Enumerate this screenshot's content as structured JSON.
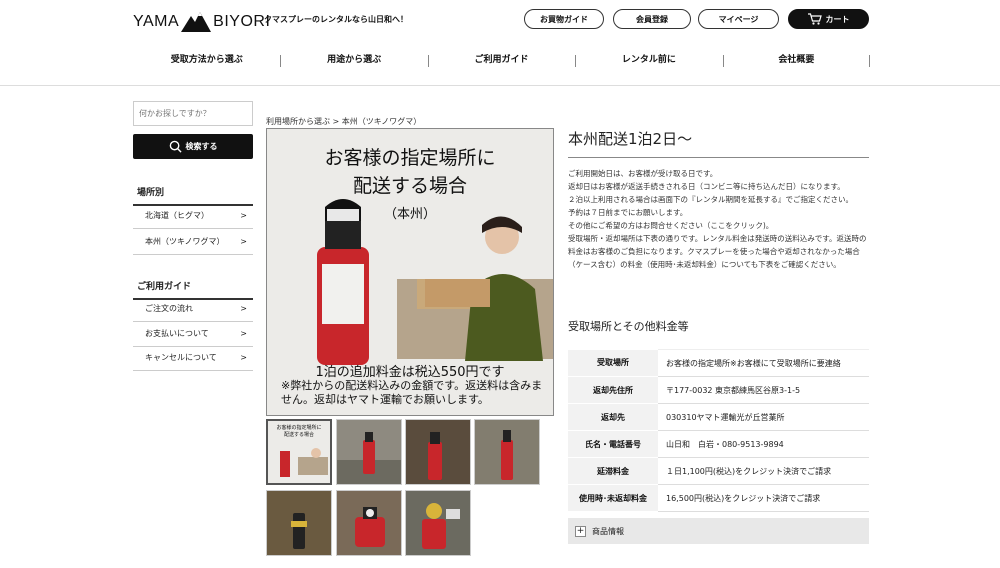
{
  "header": {
    "logo_left": "YAMA",
    "logo_right": "BIYORI",
    "tagline": "クマスプレーのレンタルなら山日和へ！",
    "buttons": {
      "guide": "お買物ガイド",
      "register": "会員登録",
      "mypage": "マイページ",
      "cart": "カート"
    },
    "nav": [
      "受取方法から選ぶ",
      "用途から選ぶ",
      "ご利用ガイド",
      "レンタル前に",
      "会社概要"
    ]
  },
  "sidebar": {
    "search_placeholder": "何かお探しですか？",
    "search_button": "検索する",
    "section1_title": "場所別",
    "section1_items": [
      "北海道（ヒグマ）",
      "本州（ツキノワグマ）"
    ],
    "section2_title": "ご利用ガイド",
    "section2_items": [
      "ご注文の流れ",
      "お支払いについて",
      "キャンセルについて"
    ],
    "arrow": ">"
  },
  "breadcrumb": "利用場所から選ぶ > 本州（ツキノワグマ）",
  "main_image": {
    "line1": "お客様の指定場所に",
    "line2": "配送する場合",
    "line3": "（本州）",
    "bottom1": "1泊の追加料金は税込550円です",
    "bottom2": "※弊社からの配送料込みの金額です。返送料は含みません。返却はヤマト運輸でお願いします。"
  },
  "thumb1": {
    "line1": "お客様の指定場所に",
    "line2": "配送する場合"
  },
  "product": {
    "title": "本州配送1泊2日〜",
    "description": [
      "ご利用開始日は、お客様が受け取る日です。",
      "返却日はお客様が返送手続きされる日（コンビニ等に持ち込んだ日）になります。",
      "２泊以上利用される場合は画面下の『レンタル期間を延長する』でご指定ください。",
      "予約は７日前までにお願いします。",
      "その他にご希望の方はお問合せください（ここをクリック)。",
      "受取場所・返却場所は下表の通りです。レンタル料金は発送時の送料込みです。返送時の料金はお客様のご負担になります。クマスプレーを使った場合や返却されなかった場合（ケース含む）の料金（使用時･未返却料金）についても下表をご確認ください。"
    ],
    "fees_title": "受取場所とその他料金等",
    "fees": [
      {
        "k": "受取場所",
        "v": "お客様の指定場所※お客様にて受取場所に要連絡"
      },
      {
        "k": "返却先住所",
        "v": "〒177-0032 東京都練馬区谷原3-1-5"
      },
      {
        "k": "返却先",
        "v": "030310ヤマト運輸光が丘営業所"
      },
      {
        "k": "氏名・電話番号",
        "v": "山日和　白岩・080-9513-9894"
      },
      {
        "k": "延滞料金",
        "v": "１日1,100円(税込)をクレジット決済でご請求"
      },
      {
        "k": "使用時･未返却料金",
        "v": "16,500円(税込)をクレジット決済でご請求"
      }
    ],
    "accordion": "商品情報"
  },
  "colors": {
    "dark": "#111111",
    "bg": "#ffffff",
    "table_key": "#f2f2f2",
    "spray_red": "#c8262b"
  }
}
